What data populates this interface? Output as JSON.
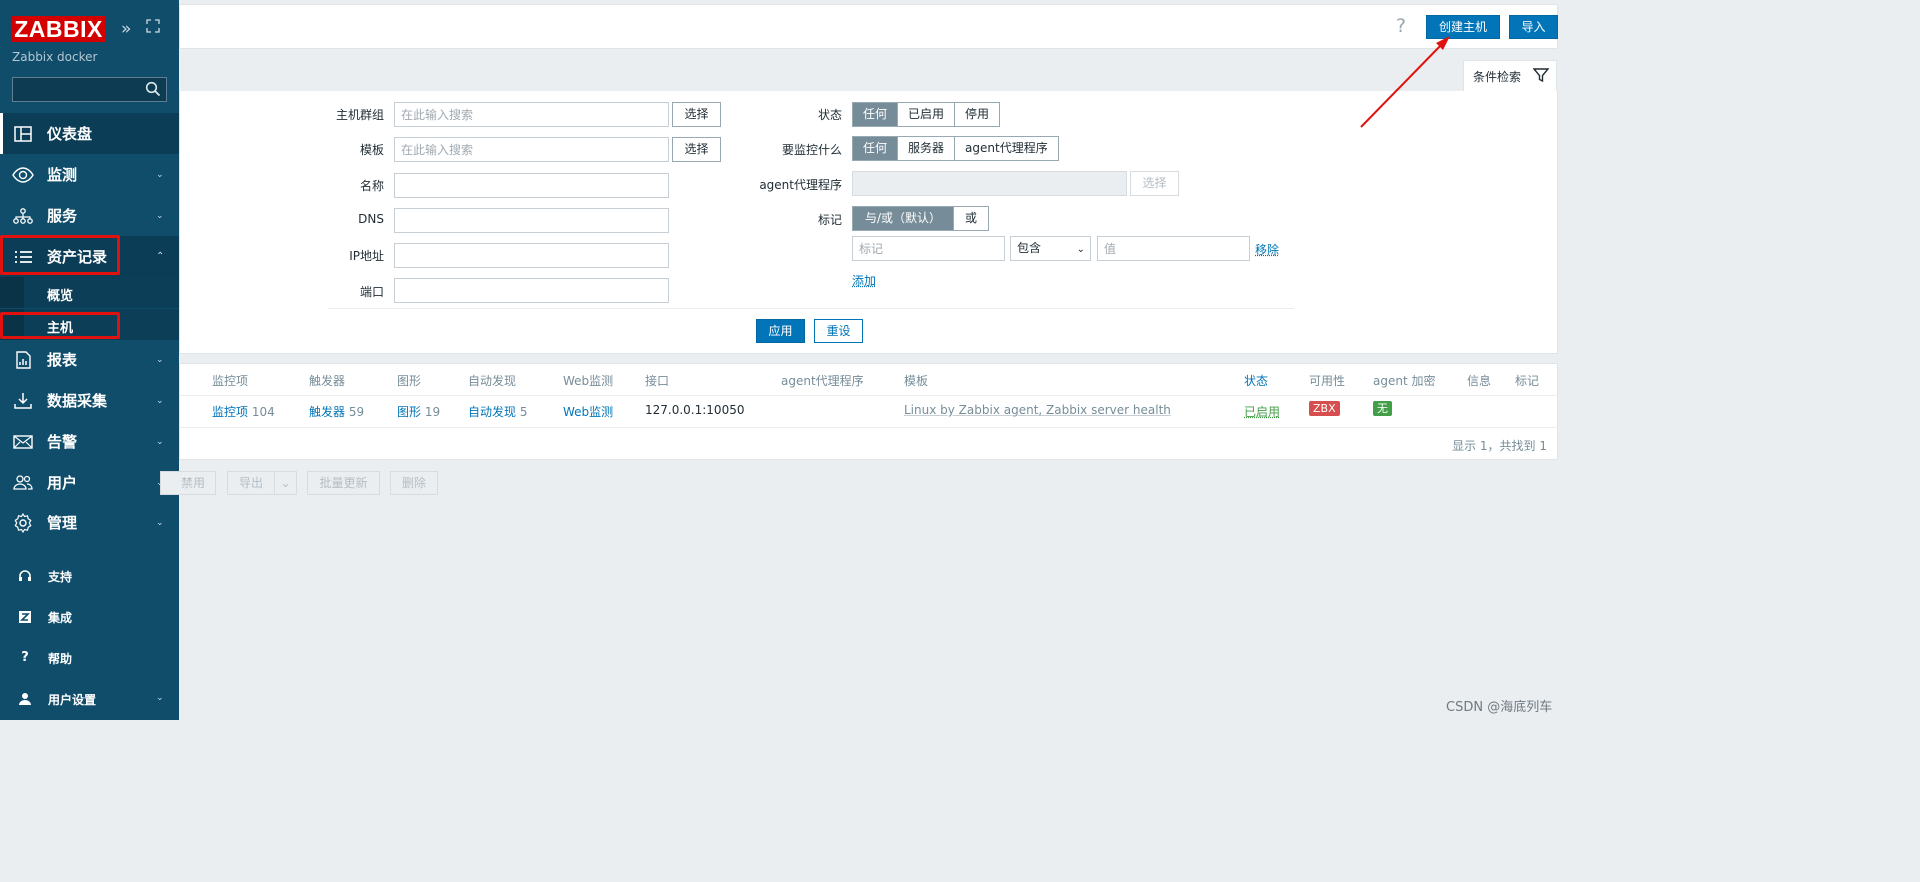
{
  "brand": {
    "logo_text": "ZABBIX",
    "server_name": "Zabbix docker"
  },
  "sidebar": {
    "collapse_icon": "double-chevron-right-icon",
    "kiosk_icon": "kiosk-mode-icon",
    "search_placeholder": "",
    "items": [
      {
        "label": "仪表盘",
        "icon": "dashboard-icon"
      },
      {
        "label": "监测",
        "icon": "eye-icon"
      },
      {
        "label": "服务",
        "icon": "services-icon"
      },
      {
        "label": "资产记录",
        "icon": "list-icon"
      },
      {
        "label": "报表",
        "icon": "report-icon"
      },
      {
        "label": "数据采集",
        "icon": "download-icon"
      },
      {
        "label": "告警",
        "icon": "envelope-icon"
      },
      {
        "label": "用户",
        "icon": "users-icon"
      },
      {
        "label": "管理",
        "icon": "gear-icon"
      }
    ],
    "submenu": [
      {
        "label": "概览"
      },
      {
        "label": "主机"
      }
    ],
    "footer": [
      {
        "label": "支持",
        "icon": "headset-icon"
      },
      {
        "label": "集成",
        "icon": "z-icon"
      },
      {
        "label": "帮助",
        "icon": "help-icon"
      },
      {
        "label": "用户设置",
        "icon": "user-icon"
      }
    ]
  },
  "header": {
    "help_icon": "?",
    "create_host": "创建主机",
    "import": "导入"
  },
  "filter": {
    "tab_label": "条件检索",
    "host_groups": {
      "label": "主机群组",
      "placeholder": "在此输入搜索",
      "select": "选择"
    },
    "templates": {
      "label": "模板",
      "placeholder": "在此输入搜索",
      "select": "选择"
    },
    "name": {
      "label": "名称",
      "value": ""
    },
    "dns": {
      "label": "DNS",
      "value": ""
    },
    "ip": {
      "label": "IP地址",
      "value": ""
    },
    "port": {
      "label": "端口",
      "value": ""
    },
    "status": {
      "label": "状态",
      "options": [
        "任何",
        "已启用",
        "停用"
      ],
      "selected": "任何"
    },
    "monitored_by": {
      "label": "要监控什么",
      "options": [
        "任何",
        "服务器",
        "agent代理程序"
      ],
      "selected": "任何"
    },
    "proxy": {
      "label": "agent代理程序",
      "select": "选择"
    },
    "tags": {
      "label": "标记",
      "options": [
        "与/或（默认）",
        "或"
      ],
      "selected": "与/或（默认）",
      "tag_placeholder": "标记",
      "operator": "包含",
      "value_placeholder": "值",
      "remove": "移除",
      "add": "添加"
    },
    "apply": "应用",
    "reset": "重设"
  },
  "table": {
    "columns": [
      "监控项",
      "触发器",
      "图形",
      "自动发现",
      "Web监测",
      "接口",
      "agent代理程序",
      "模板",
      "状态",
      "可用性",
      "agent 加密",
      "信息",
      "标记"
    ],
    "rows": [
      {
        "items_label": "监控项",
        "items_count": "104",
        "triggers_label": "触发器",
        "triggers_count": "59",
        "graphs_label": "图形",
        "graphs_count": "19",
        "discovery_label": "自动发现",
        "discovery_count": "5",
        "web": "Web监测",
        "interface": "127.0.0.1:10050",
        "proxy": "",
        "templates": "Linux by Zabbix agent, Zabbix server health",
        "status": "已启用",
        "availability": "ZBX",
        "encryption": "无",
        "info": "",
        "tags": ""
      }
    ],
    "footer": "显示 1，共找到 1",
    "colors": {
      "zbx_badge": "#d64e4e",
      "encryption_badge": "#429e47",
      "status_enabled": "#429e47"
    }
  },
  "mass_actions": {
    "disable": "禁用",
    "export": "导出",
    "mass_update": "批量更新",
    "delete": "删除"
  },
  "watermark": "CSDN @海底列车",
  "accent": "#0275b8",
  "highlight": "#e1120e"
}
